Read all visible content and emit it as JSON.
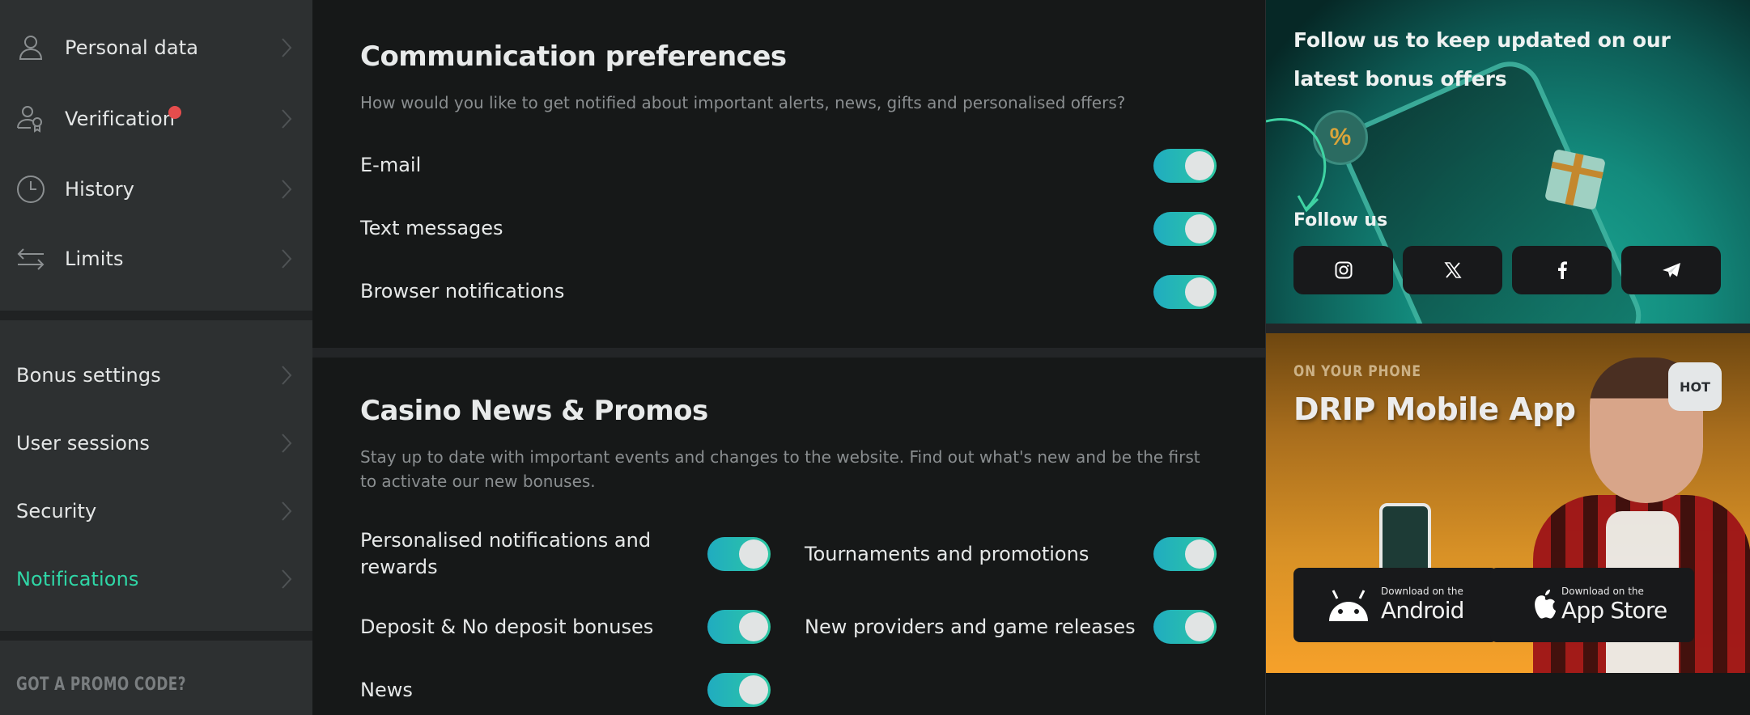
{
  "sidebar": {
    "group1": [
      {
        "label": "Personal data",
        "icon": "user-icon"
      },
      {
        "label": "Verification",
        "icon": "user-badge-icon",
        "has_alert_dot": true
      },
      {
        "label": "History",
        "icon": "clock-icon"
      },
      {
        "label": "Limits",
        "icon": "arrows-swap-icon"
      }
    ],
    "group2": [
      {
        "label": "Bonus settings"
      },
      {
        "label": "User sessions"
      },
      {
        "label": "Security"
      },
      {
        "label": "Notifications",
        "active": true
      }
    ],
    "promo_label": "GOT A PROMO CODE?"
  },
  "communication": {
    "title": "Communication preferences",
    "description": "How would you like to get notified about important alerts, news, gifts and personalised offers?",
    "items": [
      {
        "label": "E-mail",
        "enabled": true
      },
      {
        "label": "Text messages",
        "enabled": true
      },
      {
        "label": "Browser notifications",
        "enabled": true
      }
    ]
  },
  "casino_news": {
    "title": "Casino News & Promos",
    "description": "Stay up to date with important events and changes to the website. Find out what's new and be the first to activate our new bonuses.",
    "items": [
      {
        "label": "Personalised notifications and rewards",
        "enabled": true
      },
      {
        "label": "Tournaments and promotions",
        "enabled": true
      },
      {
        "label": "Deposit & No deposit bonuses",
        "enabled": true
      },
      {
        "label": "New providers and game releases",
        "enabled": true
      },
      {
        "label": "News",
        "enabled": true
      }
    ]
  },
  "social_banner": {
    "title": "Follow us to keep updated on our latest bonus offers",
    "follow_label": "Follow us",
    "coin_glyph": "%",
    "networks": [
      "instagram-icon",
      "x-icon",
      "facebook-icon",
      "telegram-icon"
    ]
  },
  "app_banner": {
    "eyebrow": "ON YOUR PHONE",
    "title": "DRIP Mobile App",
    "badge": "HOT",
    "android": {
      "small": "Download on the",
      "big": "Android"
    },
    "ios": {
      "small": "Download on the",
      "big": "App Store"
    }
  },
  "colors": {
    "accent": "#2fd6a6",
    "toggle_start": "#20acc0",
    "toggle_end": "#2dc8a3",
    "alert_dot": "#e64d4d"
  }
}
